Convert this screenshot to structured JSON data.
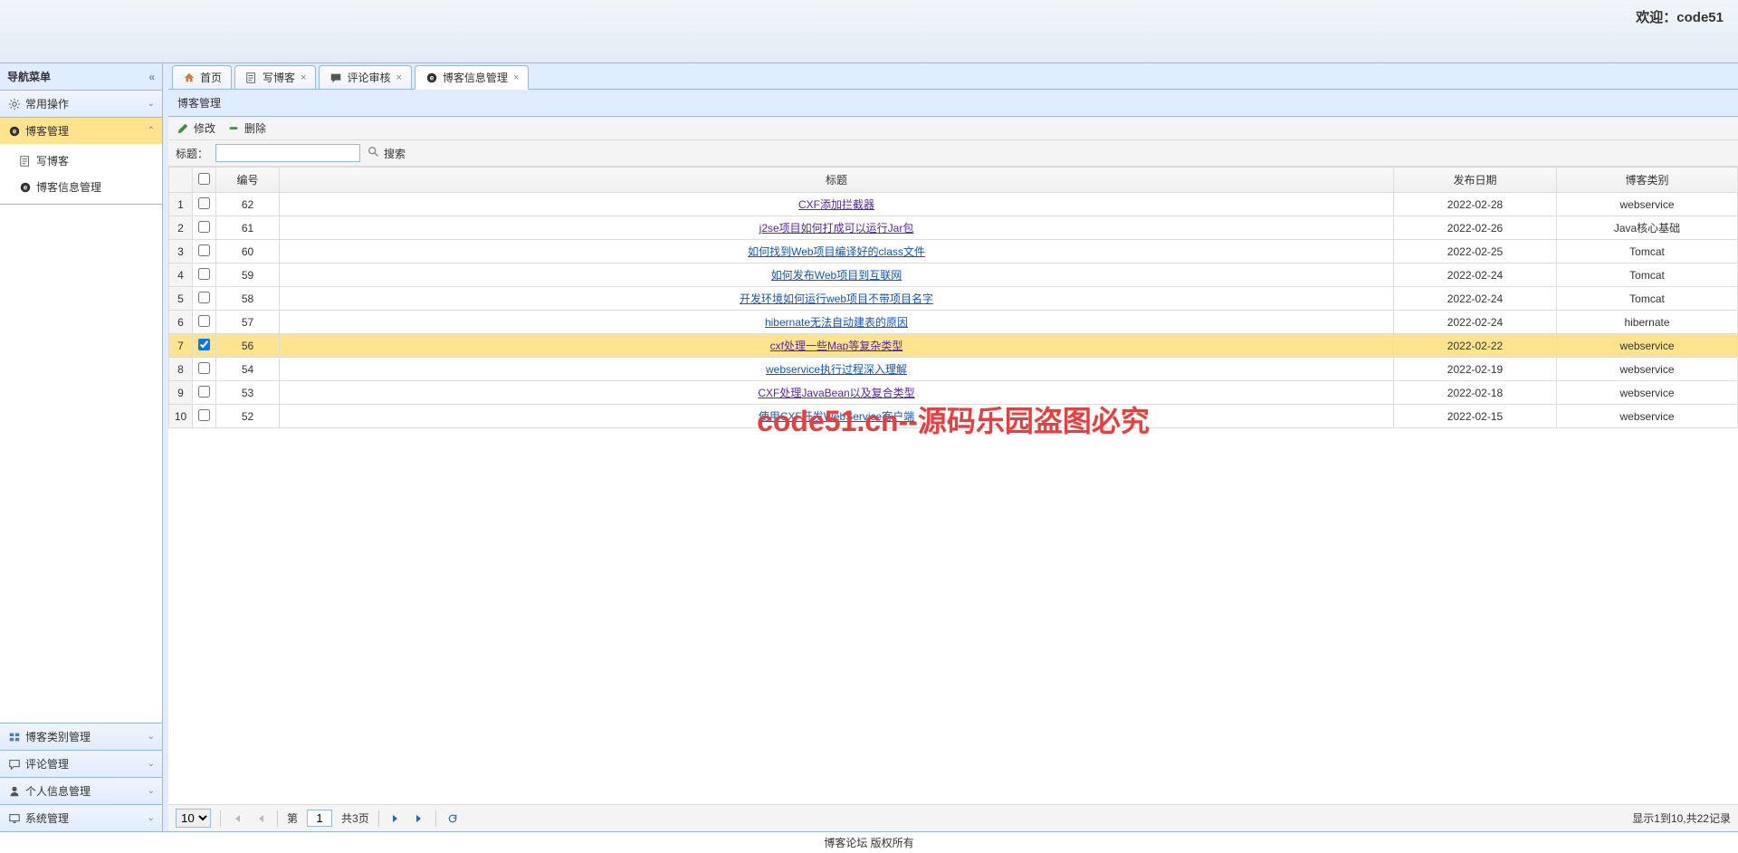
{
  "header": {
    "welcome_prefix": "欢迎：",
    "username": "code51"
  },
  "sidebar": {
    "title": "导航菜单",
    "panels": [
      {
        "label": "常用操作",
        "icon": "gear"
      },
      {
        "label": "博客管理",
        "icon": "blog",
        "active": true
      },
      {
        "label": "博客类别管理",
        "icon": "category"
      },
      {
        "label": "评论管理",
        "icon": "comment"
      },
      {
        "label": "个人信息管理",
        "icon": "person"
      },
      {
        "label": "系统管理",
        "icon": "system"
      }
    ],
    "blog_items": [
      {
        "label": "写博客",
        "icon": "write"
      },
      {
        "label": "博客信息管理",
        "icon": "blog"
      }
    ]
  },
  "tabs": [
    {
      "label": "首页",
      "icon": "home",
      "closable": false
    },
    {
      "label": "写博客",
      "icon": "write",
      "closable": true
    },
    {
      "label": "评论审核",
      "icon": "review",
      "closable": true
    },
    {
      "label": "博客信息管理",
      "icon": "blog",
      "closable": true,
      "active": true
    }
  ],
  "panel": {
    "title": "博客管理"
  },
  "toolbar": {
    "edit_label": "修改",
    "delete_label": "删除"
  },
  "search": {
    "label": "标题：",
    "value": "",
    "button": "搜索"
  },
  "grid": {
    "headers": {
      "id": "编号",
      "title": "标题",
      "date": "发布日期",
      "category": "博客类别"
    },
    "rows": [
      {
        "num": 1,
        "id": 62,
        "title": "CXF添加拦截器",
        "date": "2022-02-28",
        "category": "webservice",
        "checked": false,
        "visited": true
      },
      {
        "num": 2,
        "id": 61,
        "title": "j2se项目如何打成可以运行Jar包",
        "date": "2022-02-26",
        "category": "Java核心基础",
        "checked": false,
        "visited": true
      },
      {
        "num": 3,
        "id": 60,
        "title": "如何找到Web项目编译好的class文件",
        "date": "2022-02-25",
        "category": "Tomcat",
        "checked": false,
        "visited": false
      },
      {
        "num": 4,
        "id": 59,
        "title": "如何发布Web项目到互联网",
        "date": "2022-02-24",
        "category": "Tomcat",
        "checked": false,
        "visited": false
      },
      {
        "num": 5,
        "id": 58,
        "title": "开发环境如何运行web项目不带项目名字",
        "date": "2022-02-24",
        "category": "Tomcat",
        "checked": false,
        "visited": false
      },
      {
        "num": 6,
        "id": 57,
        "title": "hibernate无法自动建表的原因",
        "date": "2022-02-24",
        "category": "hibernate",
        "checked": false,
        "visited": false
      },
      {
        "num": 7,
        "id": 56,
        "title": "cxf处理一些Map等复杂类型",
        "date": "2022-02-22",
        "category": "webservice",
        "checked": true,
        "visited": true
      },
      {
        "num": 8,
        "id": 54,
        "title": "webservice执行过程深入理解",
        "date": "2022-02-19",
        "category": "webservice",
        "checked": false,
        "visited": false
      },
      {
        "num": 9,
        "id": 53,
        "title": "CXF处理JavaBean以及复合类型",
        "date": "2022-02-18",
        "category": "webservice",
        "checked": false,
        "visited": true
      },
      {
        "num": 10,
        "id": 52,
        "title": "使用CXF开发WebService客户端",
        "date": "2022-02-15",
        "category": "webservice",
        "checked": false,
        "visited": false
      }
    ]
  },
  "pager": {
    "page_size": "10",
    "page_label_prefix": "第",
    "page_value": "1",
    "total_pages_text": "共3页",
    "info": "显示1到10,共22记录"
  },
  "footer": {
    "text": "博客论坛 版权所有"
  },
  "watermark": "code51.cn--源码乐园盗图必究"
}
